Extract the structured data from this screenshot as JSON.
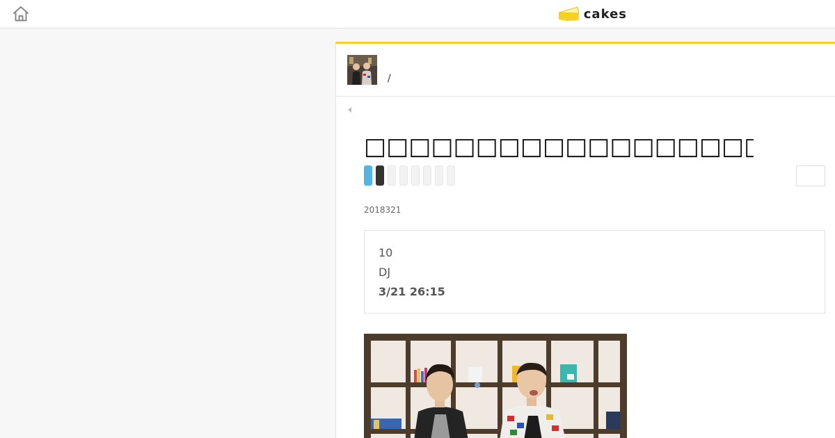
{
  "header": {
    "logo_text": "cakes",
    "icons": {
      "home": "home-icon",
      "logo": "cake-icon"
    }
  },
  "series": {
    "separator": "/"
  },
  "article": {
    "title": "□□□□□□□□□□□□□□□□□□□□□□□□□□□□□□□□□□□□□□",
    "date": "2018321",
    "info_lines": [
      "10",
      "DJ",
      "3/21 26:15"
    ]
  },
  "share_buttons": [
    "blue",
    "dark",
    "grey",
    "grey",
    "grey",
    "grey",
    "grey",
    "grey"
  ],
  "colors": {
    "accent": "#f5d21e",
    "share_blue": "#55b4e0",
    "share_dark": "#333333"
  }
}
